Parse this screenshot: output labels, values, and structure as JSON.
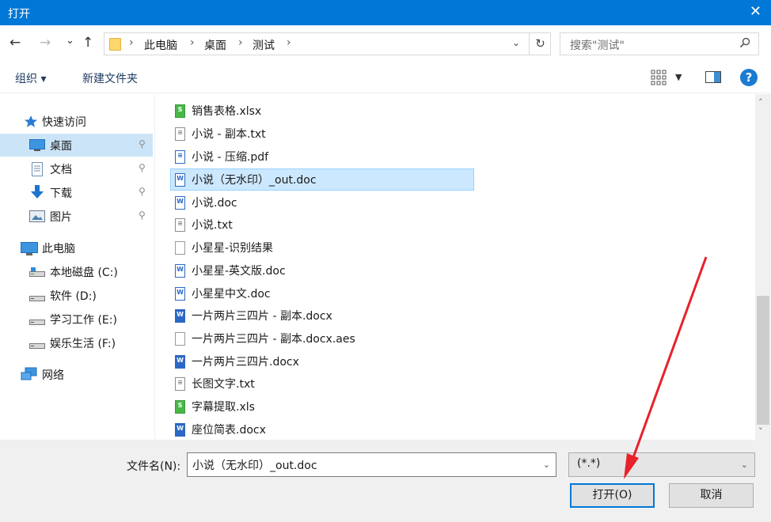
{
  "window": {
    "title": "打开",
    "close_glyph": "✕"
  },
  "nav": {
    "back": "←",
    "forward": "→",
    "recent": "⌄",
    "up": "↑"
  },
  "address": {
    "crumbs": [
      "此电脑",
      "桌面",
      "测试"
    ],
    "separator": "›",
    "dropdown": "⌄",
    "refresh": "↻"
  },
  "search": {
    "placeholder": "搜索\"测试\"",
    "icon": "search-icon"
  },
  "toolbar": {
    "organize": "组织 ▾",
    "new_folder": "新建文件夹",
    "help": "?"
  },
  "sidebar": {
    "items": [
      {
        "label": "快速访问",
        "icon": "star-icon"
      },
      {
        "label": "桌面",
        "icon": "desktop-icon",
        "pinned": true,
        "selected": true
      },
      {
        "label": "文档",
        "icon": "documents-icon",
        "pinned": true
      },
      {
        "label": "下载",
        "icon": "download-icon",
        "pinned": true
      },
      {
        "label": "图片",
        "icon": "pictures-icon",
        "pinned": true
      },
      {
        "label": "此电脑",
        "icon": "computer-icon"
      },
      {
        "label": "本地磁盘 (C:)",
        "icon": "drive-icon"
      },
      {
        "label": "软件 (D:)",
        "icon": "drive-icon"
      },
      {
        "label": "学习工作 (E:)",
        "icon": "drive-icon"
      },
      {
        "label": "娱乐生活 (F:)",
        "icon": "drive-icon"
      },
      {
        "label": "网络",
        "icon": "network-icon"
      }
    ],
    "pin_glyph": "⚲"
  },
  "files": [
    {
      "name": "销售表格.xlsx",
      "type": "xls",
      "mark": "S"
    },
    {
      "name": "小说 - 副本.txt",
      "type": "txt",
      "mark": "≡"
    },
    {
      "name": "小说 - 压缩.pdf",
      "type": "pdf",
      "mark": "≡"
    },
    {
      "name": "小说（无水印）_out.doc",
      "type": "doc",
      "mark": "W",
      "selected": true
    },
    {
      "name": "小说.doc",
      "type": "doc",
      "mark": "W"
    },
    {
      "name": "小说.txt",
      "type": "txt",
      "mark": "≡"
    },
    {
      "name": "小星星-识别结果",
      "type": "blank",
      "mark": ""
    },
    {
      "name": "小星星-英文版.doc",
      "type": "doc",
      "mark": "W"
    },
    {
      "name": "小星星中文.doc",
      "type": "doc",
      "mark": "W"
    },
    {
      "name": "一片两片三四片 - 副本.docx",
      "type": "docx",
      "mark": "W"
    },
    {
      "name": "一片两片三四片 - 副本.docx.aes",
      "type": "blank",
      "mark": ""
    },
    {
      "name": "一片两片三四片.docx",
      "type": "docx",
      "mark": "W"
    },
    {
      "name": "长图文字.txt",
      "type": "txt",
      "mark": "≡"
    },
    {
      "name": "字幕提取.xls",
      "type": "xls",
      "mark": "S"
    },
    {
      "name": "座位简表.docx",
      "type": "docx",
      "mark": "W"
    }
  ],
  "scrollbar": {
    "up": "˄",
    "down": "˅"
  },
  "footer": {
    "filename_label": "文件名(N):",
    "filename_value": "小说（无水印）_out.doc",
    "filetype_value": "(*.*)",
    "caret": "⌄",
    "open_button": "打开(O)",
    "cancel_button": "取消"
  },
  "colors": {
    "titlebar": "#0078d7",
    "selection": "#cce8ff",
    "annotation": "#e8212a"
  }
}
